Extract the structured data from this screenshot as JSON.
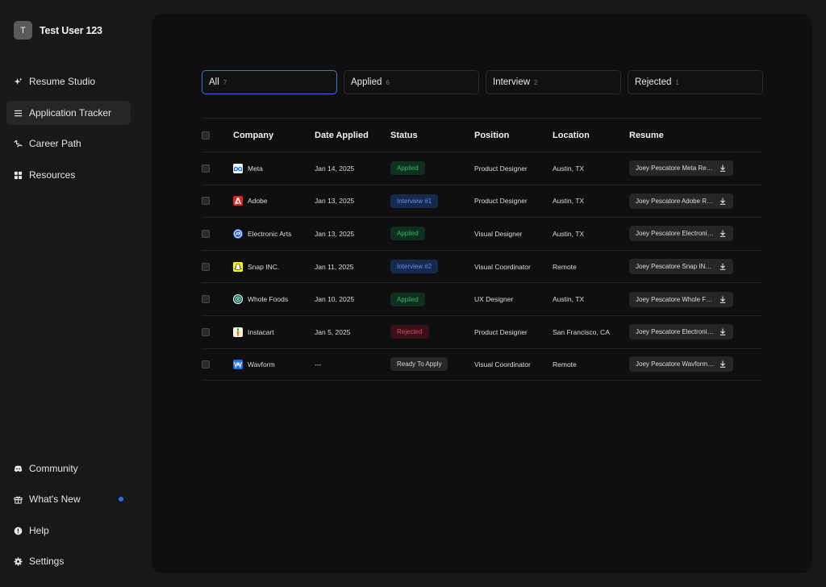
{
  "user": {
    "initial": "T",
    "name": "Test User 123"
  },
  "nav": {
    "top": [
      {
        "label": "Resume Studio",
        "icon": "sparkle-icon"
      },
      {
        "label": "Application Tracker",
        "icon": "list-icon",
        "active": true
      },
      {
        "label": "Career Path",
        "icon": "path-icon"
      },
      {
        "label": "Resources",
        "icon": "grid-icon"
      }
    ],
    "bottom": [
      {
        "label": "Community",
        "icon": "discord-icon"
      },
      {
        "label": "What's New",
        "icon": "gift-icon",
        "has_new": true
      },
      {
        "label": "Help",
        "icon": "help-icon"
      },
      {
        "label": "Settings",
        "icon": "gear-icon"
      }
    ]
  },
  "filters": [
    {
      "label": "All",
      "count": "7",
      "active": true
    },
    {
      "label": "Applied",
      "count": "6"
    },
    {
      "label": "Interview",
      "count": "2"
    },
    {
      "label": "Rejected",
      "count": "1"
    }
  ],
  "table": {
    "headers": {
      "company": "Company",
      "date": "Date Applied",
      "status": "Status",
      "position": "Position",
      "location": "Location",
      "resume": "Resume"
    },
    "rows": [
      {
        "company": "Meta",
        "date": "Jan 14, 2025",
        "status": "Applied",
        "status_type": "applied",
        "position": "Product Designer",
        "location": "Austin, TX",
        "resume": "Joey Pescatore Meta Resume"
      },
      {
        "company": "Adobe",
        "date": "Jan 13, 2025",
        "status": "Interview #1",
        "status_type": "interview",
        "position": "Product Designer",
        "location": "Austin, TX",
        "resume": "Joey Pescatore Adobe Resume"
      },
      {
        "company": "Electronic Arts",
        "date": "Jan 13, 2025",
        "status": "Applied",
        "status_type": "applied",
        "position": "Visual Designer",
        "location": "Austin, TX",
        "resume": "Joey Pescatore Electronic Arts Resume"
      },
      {
        "company": "Snap INC.",
        "date": "Jan 11, 2025",
        "status": "Interview #2",
        "status_type": "interview",
        "position": "Visual Coordinator",
        "location": "Remote",
        "resume": "Joey Pescatore Snap INC. Resume"
      },
      {
        "company": "Whole Foods",
        "date": "Jan 10, 2025",
        "status": "Applied",
        "status_type": "applied",
        "position": "UX Designer",
        "location": "Austin, TX",
        "resume": "Joey Pescatore Whole Foods Resume"
      },
      {
        "company": "Instacart",
        "date": "Jan 5, 2025",
        "status": "Rejected",
        "status_type": "rejected",
        "position": "Product Designer",
        "location": "San Francisco, CA",
        "resume": "Joey Pescatore Electronic Arts Resume"
      },
      {
        "company": "Wavform",
        "date": "---",
        "status": "Ready To Apply",
        "status_type": "ready",
        "position": "Visual Coordinator",
        "location": "Remote",
        "resume": "Joey Pescatore Wavform Resume"
      }
    ]
  },
  "colors": {
    "accent": "#2f6be6",
    "applied": "#38b46a",
    "interview": "#5f8fe6",
    "rejected": "#d64a5e"
  }
}
